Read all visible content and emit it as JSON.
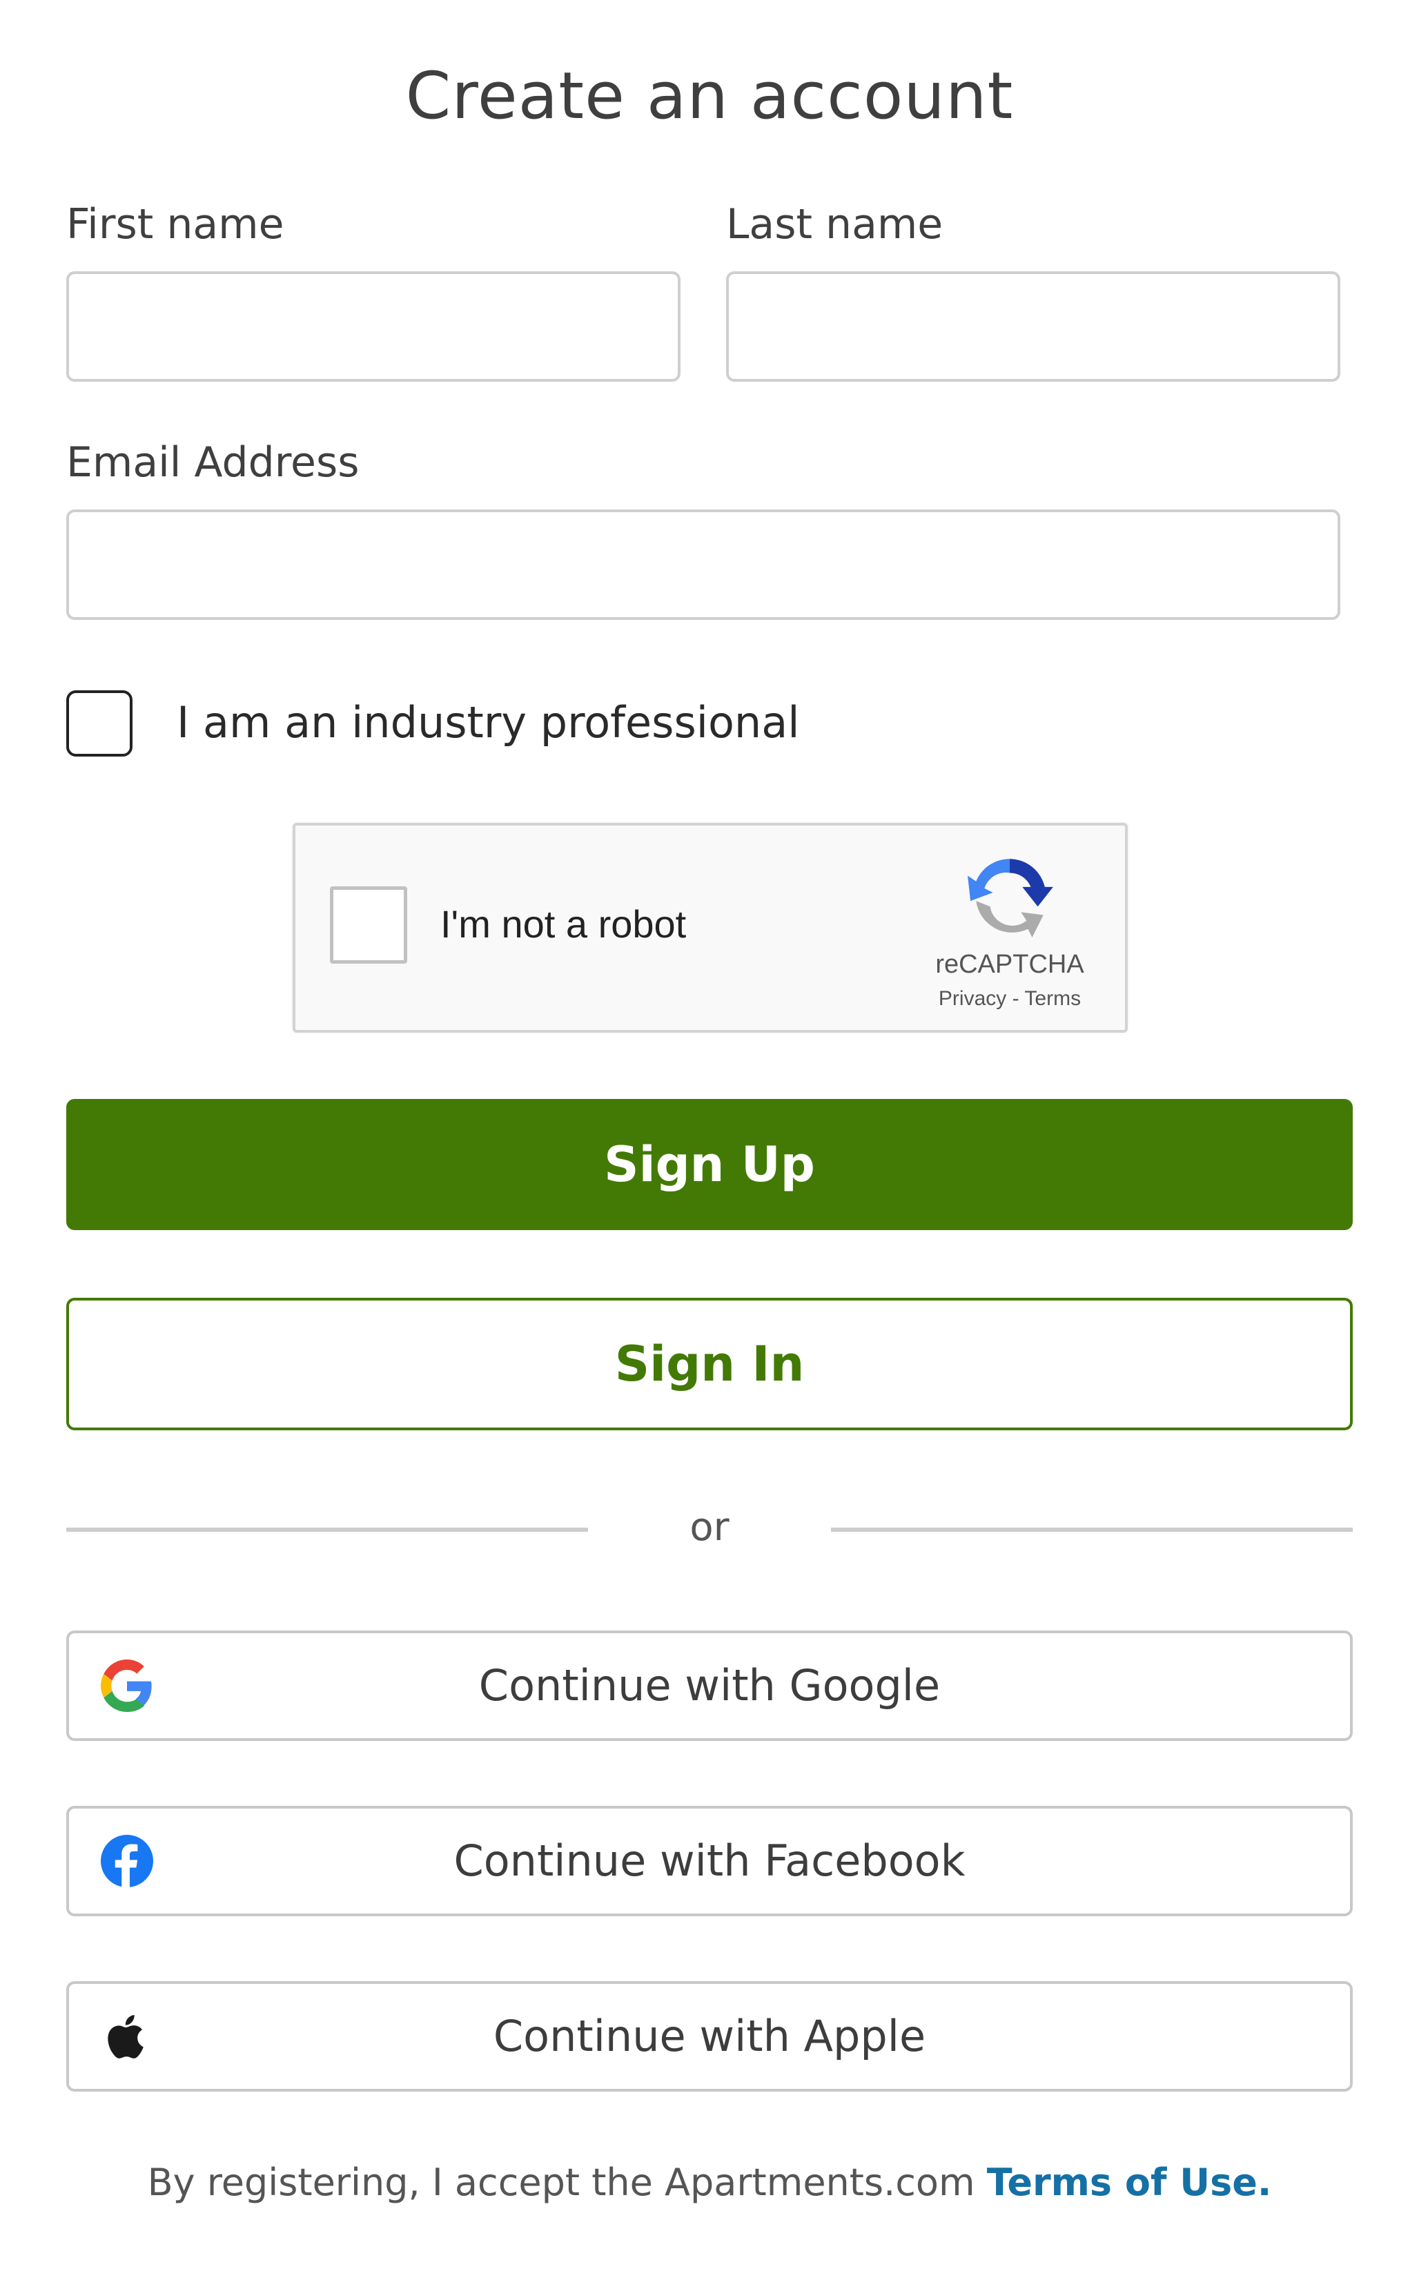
{
  "page": {
    "title": "Create an account"
  },
  "form": {
    "first_name_label": "First name",
    "first_name_value": "",
    "last_name_label": "Last name",
    "last_name_value": "",
    "email_label": "Email Address",
    "email_value": "",
    "industry_checkbox_label": "I am an industry professional",
    "industry_checked": false
  },
  "captcha": {
    "label": "I'm not a robot",
    "brand": "reCAPTCHA",
    "privacy": "Privacy",
    "separator": " - ",
    "terms": "Terms"
  },
  "buttons": {
    "sign_up": "Sign Up",
    "sign_in": "Sign In"
  },
  "divider": {
    "text": "or"
  },
  "social": {
    "google": "Continue with Google",
    "facebook": "Continue with Facebook",
    "apple": "Continue with Apple"
  },
  "footer": {
    "text": "By registering, I accept the Apartments.com",
    "link": "Terms of Use."
  },
  "colors": {
    "primary_green": "#437a05",
    "link_blue": "#1570a6",
    "facebook_blue": "#1877f2"
  }
}
